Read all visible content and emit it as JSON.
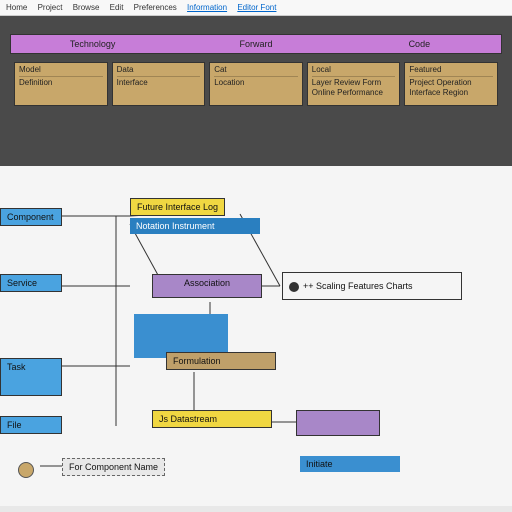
{
  "menubar": {
    "items": [
      "Home",
      "Project",
      "Browse",
      "Edit",
      "Preferences"
    ],
    "link1": "Information",
    "link2": "Editor Font"
  },
  "header": {
    "col1": "Technology",
    "col2": "Forward",
    "col3": "Code"
  },
  "cards": [
    {
      "title": "Model",
      "body": "Definition"
    },
    {
      "title": "Data",
      "body": "Interface"
    },
    {
      "title": "Cat",
      "body": "Location"
    },
    {
      "title": "Local",
      "body": "Layer Review Form Online Performance"
    },
    {
      "title": "Featured",
      "body": "Project Operation Interface Region"
    }
  ],
  "nodes": {
    "left1": "Component",
    "left2": "Service",
    "left3": "Task",
    "left4": "File",
    "n1a": "Future Interface Log",
    "n1b": "Notation Instrument",
    "n2": "Association",
    "n2r": "++ Scaling Features Charts",
    "n3": "Formulation",
    "n4": "Js Datastream",
    "n5a": "For Component Name",
    "n5b": "Initiate"
  }
}
